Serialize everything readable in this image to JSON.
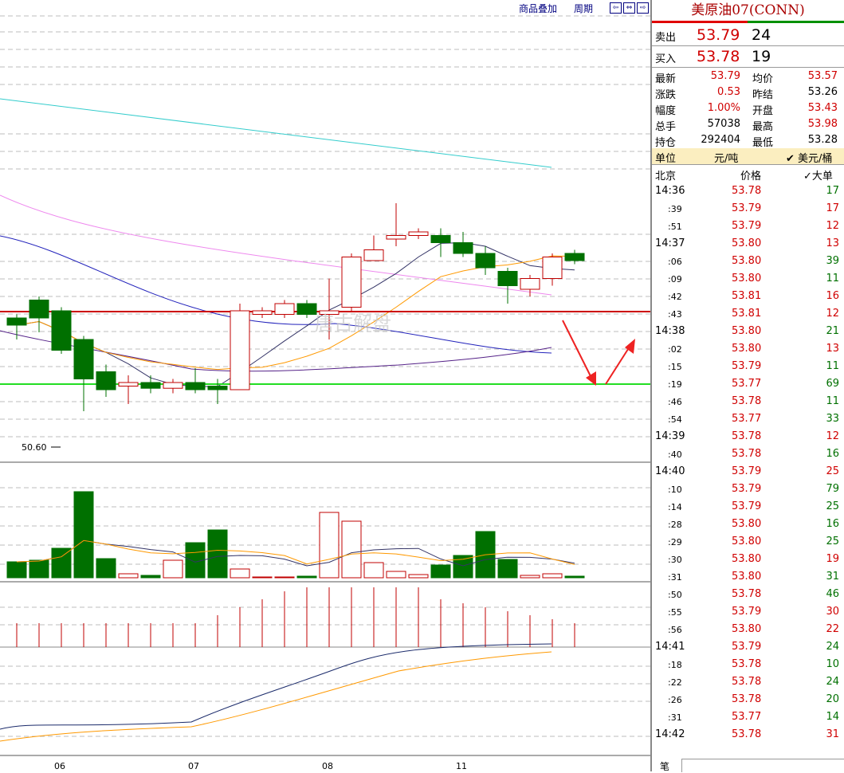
{
  "toolbar": {
    "overlay_label": "商品叠加",
    "period_label": "周期",
    "nav_left": "⇦",
    "nav_fit": "⇔",
    "nav_right": "⇨"
  },
  "chart": {
    "low_label": "50.60",
    "watermark": "唐古解盘",
    "date_labels": [
      "06",
      "07",
      "08",
      "11"
    ],
    "colors": {
      "up": "#c00000",
      "down": "#007000",
      "ma_cyan": "#33cccc",
      "ma_pink": "#ee88ee",
      "ma_blue": "#2222bb",
      "ma_orange": "#ff9900",
      "ma_navy": "#1a2a6a",
      "resistance": "#cc0000",
      "support": "#22dd22",
      "arrow": "#ee2222"
    }
  },
  "chart_data": {
    "type": "candlestick",
    "candles": [
      {
        "open": 51.9,
        "close": 51.8,
        "high": 51.95,
        "low": 51.6
      },
      {
        "open": 52.15,
        "close": 51.9,
        "high": 52.2,
        "low": 51.7
      },
      {
        "open": 52.0,
        "close": 51.45,
        "high": 52.05,
        "low": 51.4
      },
      {
        "open": 51.6,
        "close": 51.05,
        "high": 51.65,
        "low": 50.6
      },
      {
        "open": 51.15,
        "close": 50.9,
        "high": 51.25,
        "low": 50.8
      },
      {
        "open": 50.95,
        "close": 51.0,
        "high": 51.1,
        "low": 50.7
      },
      {
        "open": 51.0,
        "close": 50.92,
        "high": 51.1,
        "low": 50.85
      },
      {
        "open": 50.92,
        "close": 51.0,
        "high": 51.05,
        "low": 50.85
      },
      {
        "open": 51.0,
        "close": 50.9,
        "high": 51.2,
        "low": 50.85
      },
      {
        "open": 50.95,
        "close": 50.9,
        "high": 51.05,
        "low": 50.7
      },
      {
        "open": 50.9,
        "close": 52.0,
        "high": 52.1,
        "low": 50.9
      },
      {
        "open": 51.95,
        "close": 52.0,
        "high": 52.05,
        "low": 51.9
      },
      {
        "open": 51.95,
        "close": 52.1,
        "high": 52.15,
        "low": 51.9
      },
      {
        "open": 52.1,
        "close": 51.95,
        "high": 52.15,
        "low": 51.9
      },
      {
        "open": 51.95,
        "close": 52.0,
        "high": 52.45,
        "low": 51.6
      },
      {
        "open": 52.05,
        "close": 52.75,
        "high": 52.8,
        "low": 52.0
      },
      {
        "open": 52.7,
        "close": 52.85,
        "high": 53.05,
        "low": 52.7
      },
      {
        "open": 53.0,
        "close": 53.05,
        "high": 53.5,
        "low": 52.9
      },
      {
        "open": 53.05,
        "close": 53.1,
        "high": 53.15,
        "low": 53.0
      },
      {
        "open": 53.05,
        "close": 52.95,
        "high": 53.15,
        "low": 52.75
      },
      {
        "open": 52.95,
        "close": 52.8,
        "high": 53.1,
        "low": 52.75
      },
      {
        "open": 52.8,
        "close": 52.6,
        "high": 52.9,
        "low": 52.5
      },
      {
        "open": 52.55,
        "close": 52.35,
        "high": 52.6,
        "low": 52.1
      },
      {
        "open": 52.3,
        "close": 52.45,
        "high": 52.5,
        "low": 52.2
      },
      {
        "open": 52.45,
        "close": 52.75,
        "high": 52.8,
        "low": 52.35
      },
      {
        "open": 52.8,
        "close": 52.7,
        "high": 52.85,
        "low": 52.65
      }
    ],
    "volume": [
      20,
      22,
      37,
      108,
      24,
      5,
      3,
      22,
      44,
      60,
      11,
      1,
      1,
      2,
      82,
      71,
      19,
      8,
      4,
      16,
      28,
      58,
      23,
      3,
      5,
      2
    ]
  },
  "quote": {
    "title": "美原油07(CONN)",
    "sell_label": "卖出",
    "sell_price": "53.79",
    "sell_vol": "24",
    "buy_label": "买入",
    "buy_price": "53.78",
    "buy_vol": "19",
    "rows": [
      {
        "l1": "最新",
        "v1": "53.79",
        "l2": "均价",
        "v2": "53.57"
      },
      {
        "l1": "涨跌",
        "v1": "0.53",
        "l2": "昨结",
        "v2": "53.26"
      },
      {
        "l1": "幅度",
        "v1": "1.00%",
        "l2": "开盘",
        "v2": "53.43"
      },
      {
        "l1": "总手",
        "v1": "57038",
        "l2": "最高",
        "v2": "53.98"
      },
      {
        "l1": "持仓",
        "v1": "292404",
        "l2": "最低",
        "v2": "53.28"
      }
    ],
    "unit_label": "单位",
    "unit_cny": "元/吨",
    "unit_usd": "✔ 美元/桶"
  },
  "ticks": {
    "head_time": "北京",
    "head_price": "价格",
    "head_vol": "✓大单",
    "rows": [
      {
        "t": "14:36",
        "p": "53.78",
        "v": "17"
      },
      {
        "t": ":39",
        "p": "53.79",
        "v": "17"
      },
      {
        "t": ":51",
        "p": "53.79",
        "v": "12"
      },
      {
        "t": "14:37",
        "p": "53.80",
        "v": "13"
      },
      {
        "t": ":06",
        "p": "53.80",
        "v": "39"
      },
      {
        "t": ":09",
        "p": "53.80",
        "v": "11"
      },
      {
        "t": ":42",
        "p": "53.81",
        "v": "16"
      },
      {
        "t": ":43",
        "p": "53.81",
        "v": "12"
      },
      {
        "t": "14:38",
        "p": "53.80",
        "v": "21"
      },
      {
        "t": ":02",
        "p": "53.80",
        "v": "13"
      },
      {
        "t": ":15",
        "p": "53.79",
        "v": "11"
      },
      {
        "t": ":19",
        "p": "53.77",
        "v": "69"
      },
      {
        "t": ":46",
        "p": "53.78",
        "v": "11"
      },
      {
        "t": ":54",
        "p": "53.77",
        "v": "33"
      },
      {
        "t": "14:39",
        "p": "53.78",
        "v": "12"
      },
      {
        "t": ":40",
        "p": "53.78",
        "v": "16"
      },
      {
        "t": "14:40",
        "p": "53.79",
        "v": "25"
      },
      {
        "t": ":10",
        "p": "53.79",
        "v": "79"
      },
      {
        "t": ":14",
        "p": "53.79",
        "v": "25"
      },
      {
        "t": ":28",
        "p": "53.80",
        "v": "16"
      },
      {
        "t": ":29",
        "p": "53.80",
        "v": "25"
      },
      {
        "t": ":30",
        "p": "53.80",
        "v": "19"
      },
      {
        "t": ":31",
        "p": "53.80",
        "v": "31"
      },
      {
        "t": ":50",
        "p": "53.78",
        "v": "46"
      },
      {
        "t": ":55",
        "p": "53.79",
        "v": "30"
      },
      {
        "t": ":56",
        "p": "53.80",
        "v": "22"
      },
      {
        "t": "14:41",
        "p": "53.79",
        "v": "24"
      },
      {
        "t": ":18",
        "p": "53.78",
        "v": "10"
      },
      {
        "t": ":22",
        "p": "53.78",
        "v": "24"
      },
      {
        "t": ":26",
        "p": "53.78",
        "v": "20"
      },
      {
        "t": ":31",
        "p": "53.77",
        "v": "14"
      },
      {
        "t": "14:42",
        "p": "53.78",
        "v": "31"
      }
    ],
    "tick_colors": [
      "green",
      "red",
      "red",
      "red",
      "green",
      "green",
      "red",
      "red",
      "green",
      "red",
      "green",
      "green",
      "green",
      "green",
      "red",
      "green",
      "red",
      "green",
      "green",
      "green",
      "green",
      "red",
      "green",
      "green",
      "red",
      "red",
      "green",
      "green",
      "green",
      "green",
      "green",
      "red"
    ]
  },
  "footer": {
    "left_label": "笔"
  }
}
